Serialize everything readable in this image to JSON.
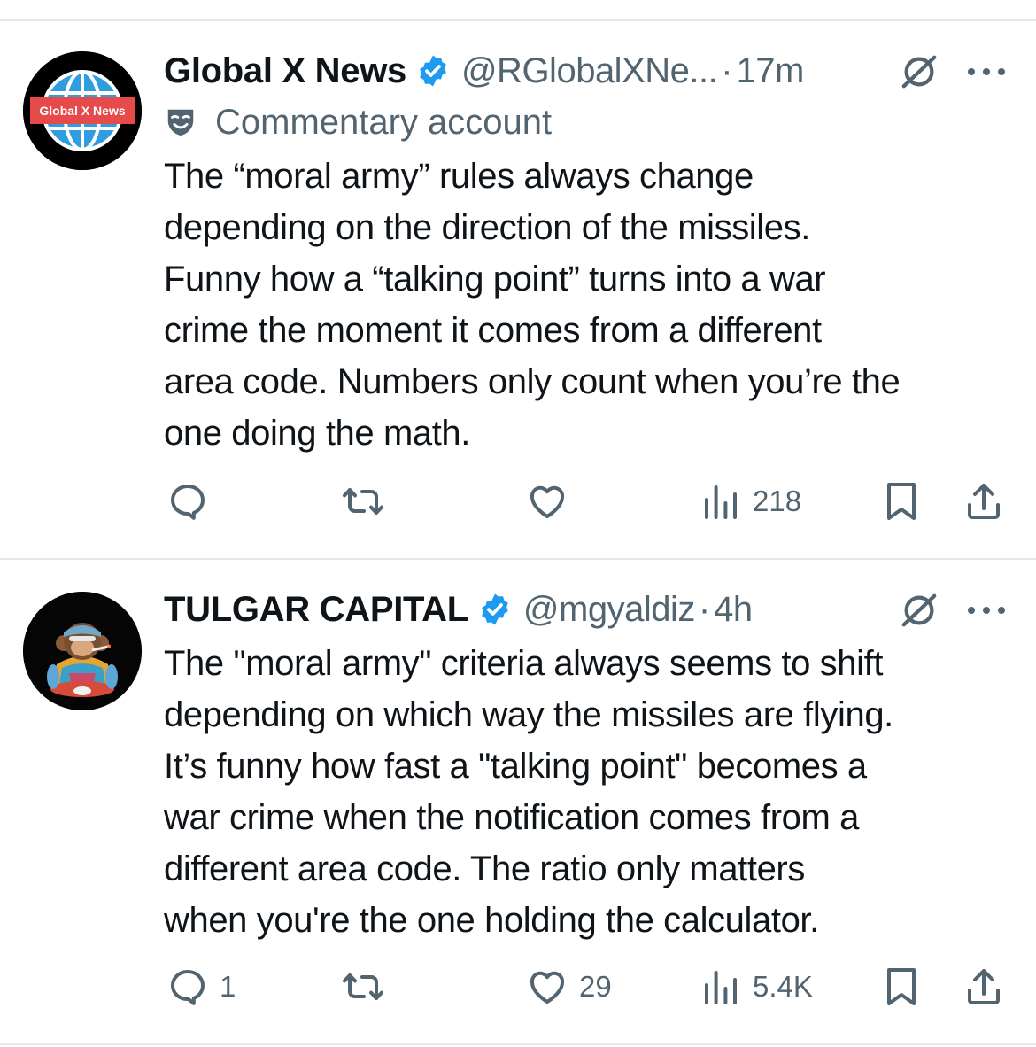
{
  "tweets": [
    {
      "avatar_text": "Global X News",
      "name": "Global X News",
      "handle": "@RGlobalXNe...",
      "separator": "·",
      "time": "17m",
      "label": "Commentary account",
      "lines": [
        "The “moral army” rules always change",
        "depending on the direction of the missiles.",
        "Funny how a “talking point” turns into a war",
        "crime the moment it comes from a different",
        "area code. Numbers only count when you’re the",
        "one doing the math."
      ],
      "stats": {
        "replies": "",
        "reposts": "",
        "likes": "",
        "views": "218"
      }
    },
    {
      "name": "TULGAR CAPITAL",
      "handle": "@mgyaldiz",
      "separator": "·",
      "time": "4h",
      "lines": [
        "The \"moral army\" criteria always seems to shift",
        "depending on which way the missiles are flying.",
        "It’s funny how fast a \"talking point\" becomes a",
        "war crime when the notification comes from a",
        "different area code. The ratio only matters",
        "when you're the one holding the calculator."
      ],
      "stats": {
        "replies": "1",
        "reposts": "",
        "likes": "29",
        "views": "5.4K"
      }
    }
  ],
  "colors": {
    "verified": "#1d9bf0",
    "text": "#0f1419",
    "secondary": "#536471",
    "divider": "#e6e9ec"
  },
  "icons": [
    "verified-badge-icon",
    "grok-icon",
    "more-icon",
    "parody-mask-icon",
    "reply-icon",
    "repost-icon",
    "like-icon",
    "views-icon",
    "bookmark-icon",
    "share-icon"
  ]
}
